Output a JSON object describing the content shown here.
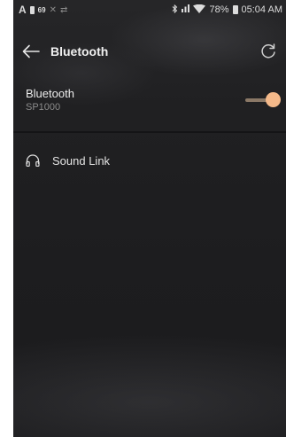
{
  "status_bar": {
    "app_mark": "A",
    "volume": "69",
    "battery_percent": "78%",
    "time": "05:04 AM"
  },
  "header": {
    "title": "Bluetooth"
  },
  "bluetooth": {
    "label": "Bluetooth",
    "device_name": "SP1000",
    "enabled": true
  },
  "devices": [
    {
      "name": "Sound Link",
      "icon": "headphones-icon"
    }
  ],
  "colors": {
    "background": "#1d1d1f",
    "accent": "#f4b98a",
    "text": "#ececec",
    "subtext": "#8c8c8c"
  }
}
